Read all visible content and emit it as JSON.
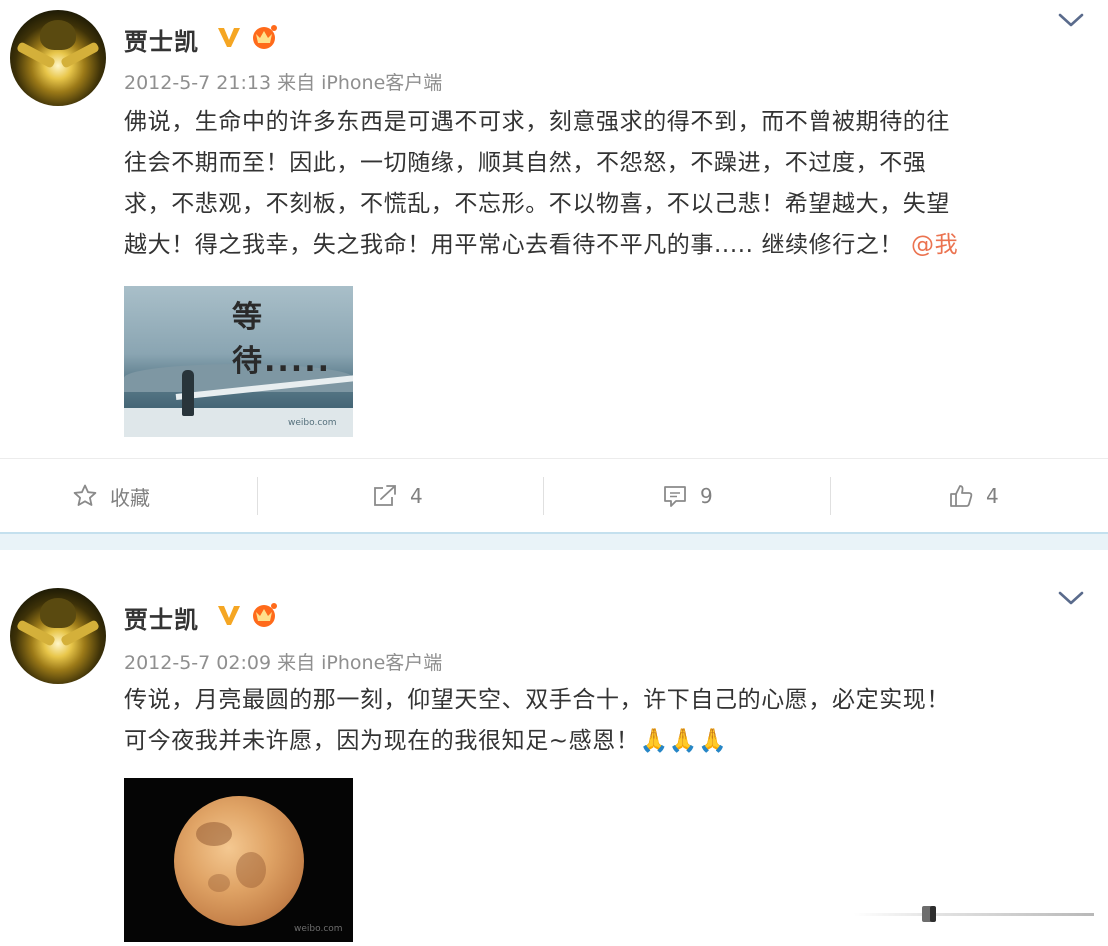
{
  "posts": [
    {
      "username": "贾士凯",
      "timestamp": "2012-5-7 21:13",
      "source": "来自 iPhone客户端",
      "content_lines": [
        "佛说，生命中的许多东西是可遇不可求，刻意强求的得不到，而不曾被期待的往",
        "往会不期而至！因此，一切随缘，顺其自然，不怨怒，不躁进，不过度，不强",
        "求，不悲观，不刻板，不慌乱，不忘形。不以物喜，不以己悲！希望越大，失望",
        "越大！得之我幸，失之我命！用平常心去看待不平凡的事..... 继续修行之！"
      ],
      "mention": "@我",
      "image": {
        "caption_text": "等待.....",
        "watermark": "weibo.com"
      },
      "actions": {
        "favorite_label": "收藏",
        "repost_count": "4",
        "comment_count": "9",
        "like_count": "4"
      }
    },
    {
      "username": "贾士凯",
      "timestamp": "2012-5-7 02:09",
      "source": "来自 iPhone客户端",
      "content_lines": [
        "传说，月亮最圆的那一刻，仰望天空、双手合十，许下自己的心愿，必定实现！",
        "可今夜我并未许愿，因为现在的我很知足~感恩！🙏🙏🙏"
      ],
      "image": {
        "watermark": "weibo.com"
      }
    }
  ],
  "icons": {
    "verified": "v-badge-icon",
    "member": "crown-icon",
    "expand": "chevron-down-icon",
    "favorite": "star-icon",
    "repost": "share-icon",
    "comment": "comment-icon",
    "like": "thumbs-up-icon"
  },
  "colors": {
    "verified_badge": "#f5a623",
    "member_badge": "#ff6a1a",
    "mention": "#eb7350",
    "divider_band": "#e9f3f8"
  }
}
